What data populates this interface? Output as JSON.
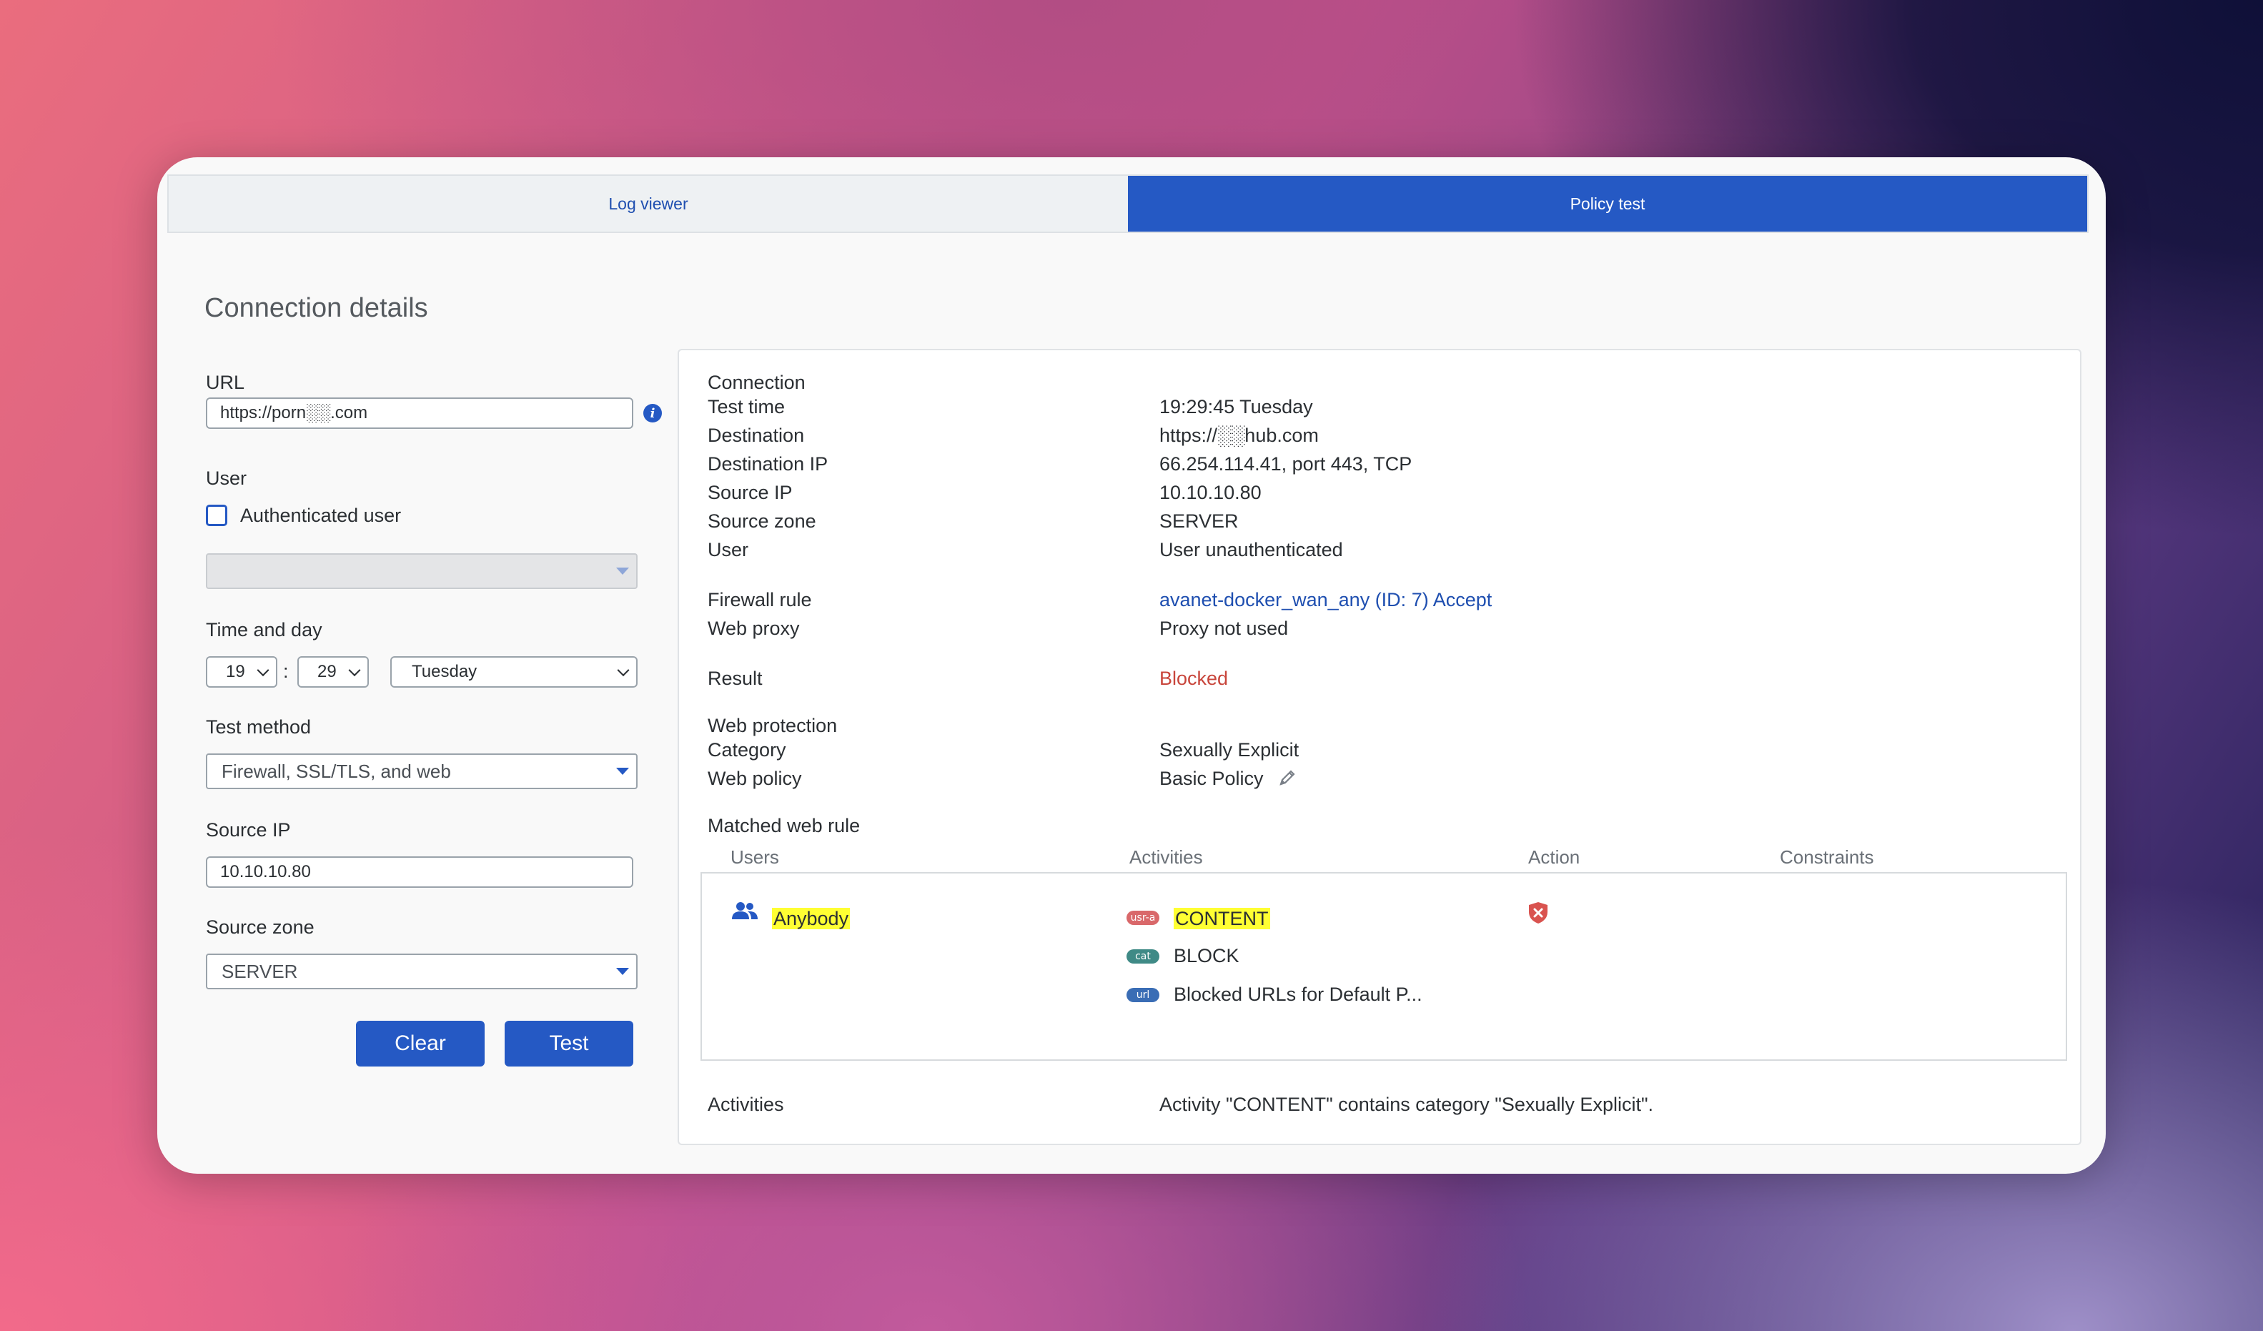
{
  "tabs": [
    {
      "label": "Log viewer",
      "active": false
    },
    {
      "label": "Policy test",
      "active": true
    }
  ],
  "page_title": "Connection details",
  "form": {
    "url_label": "URL",
    "url_value": "https://porn░░.com",
    "user_label": "User",
    "authenticated_label": "Authenticated user",
    "authenticated_checked": false,
    "user_select_value": "",
    "time_label": "Time and day",
    "hour": "19",
    "time_separator": ":",
    "minute": "29",
    "day": "Tuesday",
    "method_label": "Test method",
    "method_value": "Firewall, SSL/TLS, and web",
    "source_ip_label": "Source IP",
    "source_ip_value": "10.10.10.80",
    "source_zone_label": "Source zone",
    "source_zone_value": "SERVER",
    "clear_label": "Clear",
    "test_label": "Test"
  },
  "details": {
    "connection_heading": "Connection",
    "test_time_key": "Test time",
    "test_time_value": "19:29:45 Tuesday",
    "destination_key": "Destination",
    "destination_value": "https://░░hub.com",
    "destination_ip_key": "Destination IP",
    "destination_ip_value": "66.254.114.41, port 443, TCP",
    "source_ip_key": "Source IP",
    "source_ip_value": "10.10.10.80",
    "source_zone_key": "Source zone",
    "source_zone_value": "SERVER",
    "user_key": "User",
    "user_value": "User unauthenticated",
    "firewall_rule_key": "Firewall rule",
    "firewall_rule_value": "avanet-docker_wan_any (ID: 7) Accept",
    "web_proxy_key": "Web proxy",
    "web_proxy_value": "Proxy not used",
    "result_key": "Result",
    "result_value": "Blocked",
    "web_protection_heading": "Web protection",
    "category_key": "Category",
    "category_value": "Sexually Explicit",
    "web_policy_key": "Web policy",
    "web_policy_value": "Basic Policy",
    "matched_rule_heading": "Matched web rule",
    "col_users": "Users",
    "col_activities": "Activities",
    "col_action": "Action",
    "col_constraints": "Constraints",
    "rule_user": "Anybody",
    "activity_1_tag": "usr-a",
    "activity_1": "CONTENT",
    "activity_2_tag": "cat",
    "activity_2": "BLOCK",
    "activity_3_tag": "url",
    "activity_3": "Blocked URLs for Default P...",
    "activities_key": "Activities",
    "activities_value": "Activity \"CONTENT\" contains category \"Sexually Explicit\"."
  },
  "colors": {
    "accent": "#2559c4",
    "blocked": "#c8453b",
    "highlight": "#ffff33",
    "tag_usr": "#d9686a",
    "tag_cat": "#3f8a86",
    "tag_url": "#3a6db5"
  }
}
